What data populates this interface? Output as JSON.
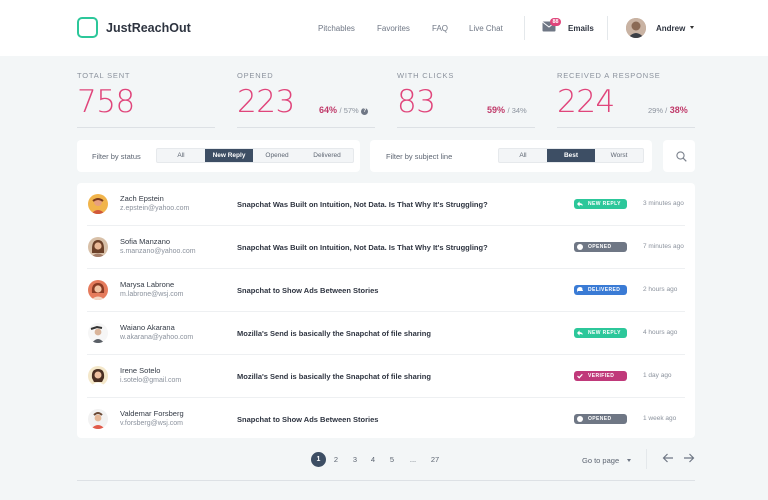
{
  "header": {
    "app_name": "JustReachOut",
    "nav": [
      "Pitchables",
      "Favorites",
      "FAQ",
      "Live Chat"
    ],
    "emails_label": "Emails",
    "emails_badge": "88",
    "user_name": "Andrew"
  },
  "stats": [
    {
      "label": "TOTAL SENT",
      "value": "758"
    },
    {
      "label": "OPENED",
      "value": "223",
      "pct": "64%",
      "sub": "/ 57%"
    },
    {
      "label": "WITH CLICKS",
      "value": "83",
      "pct": "59%",
      "sub": "/ 34%"
    },
    {
      "label": "RECEIVED A RESPONSE",
      "value": "224",
      "sub": "29% /",
      "pct": "38%"
    }
  ],
  "filters": {
    "status_label": "Filter by status",
    "status_options": [
      "All",
      "New Reply",
      "Opened",
      "Delivered"
    ],
    "status_active": "New Reply",
    "subject_label": "Filter by subject line",
    "subject_options": [
      "All",
      "Best",
      "Worst"
    ],
    "subject_active": "Best"
  },
  "rows": [
    {
      "name": "Zach Epstein",
      "email": "z.epstein@yahoo.com",
      "subject": "Snapchat Was Built on Intuition, Not Data. Is That Why It's Struggling?",
      "status": "NEW REPLY",
      "time": "3 minutes ago"
    },
    {
      "name": "Sofia Manzano",
      "email": "s.manzano@yahoo.com",
      "subject": "Snapchat Was Built on Intuition, Not Data. Is That Why It's Struggling?",
      "status": "OPENED",
      "time": "7 minutes ago"
    },
    {
      "name": "Marysa Labrone",
      "email": "m.labrone@wsj.com",
      "subject": "Snapchat to Show Ads Between Stories",
      "status": "DELIVERED",
      "time": "2 hours ago"
    },
    {
      "name": "Waiano Akarana",
      "email": "w.akarana@yahoo.com",
      "subject": "Mozilla's Send is basically the Snapchat of file sharing",
      "status": "NEW REPLY",
      "time": "4 hours ago"
    },
    {
      "name": "Irene Sotelo",
      "email": "i.sotelo@gmail.com",
      "subject": "Mozilla's Send is basically the Snapchat of file sharing",
      "status": "VERIFIED",
      "time": "1 day ago"
    },
    {
      "name": "Valdemar Forsberg",
      "email": "v.forsberg@wsj.com",
      "subject": "Snapchat to Show Ads Between Stories",
      "status": "OPENED",
      "time": "1 week ago"
    }
  ],
  "status_colors": {
    "NEW REPLY": "#2cc79a",
    "OPENED": "#6f7785",
    "DELIVERED": "#3a7bd5",
    "VERIFIED": "#c0397a"
  },
  "pagination": {
    "pages": [
      "1",
      "2",
      "3",
      "4",
      "5",
      "...",
      "27"
    ],
    "current": "1",
    "goto_label": "Go to page"
  }
}
